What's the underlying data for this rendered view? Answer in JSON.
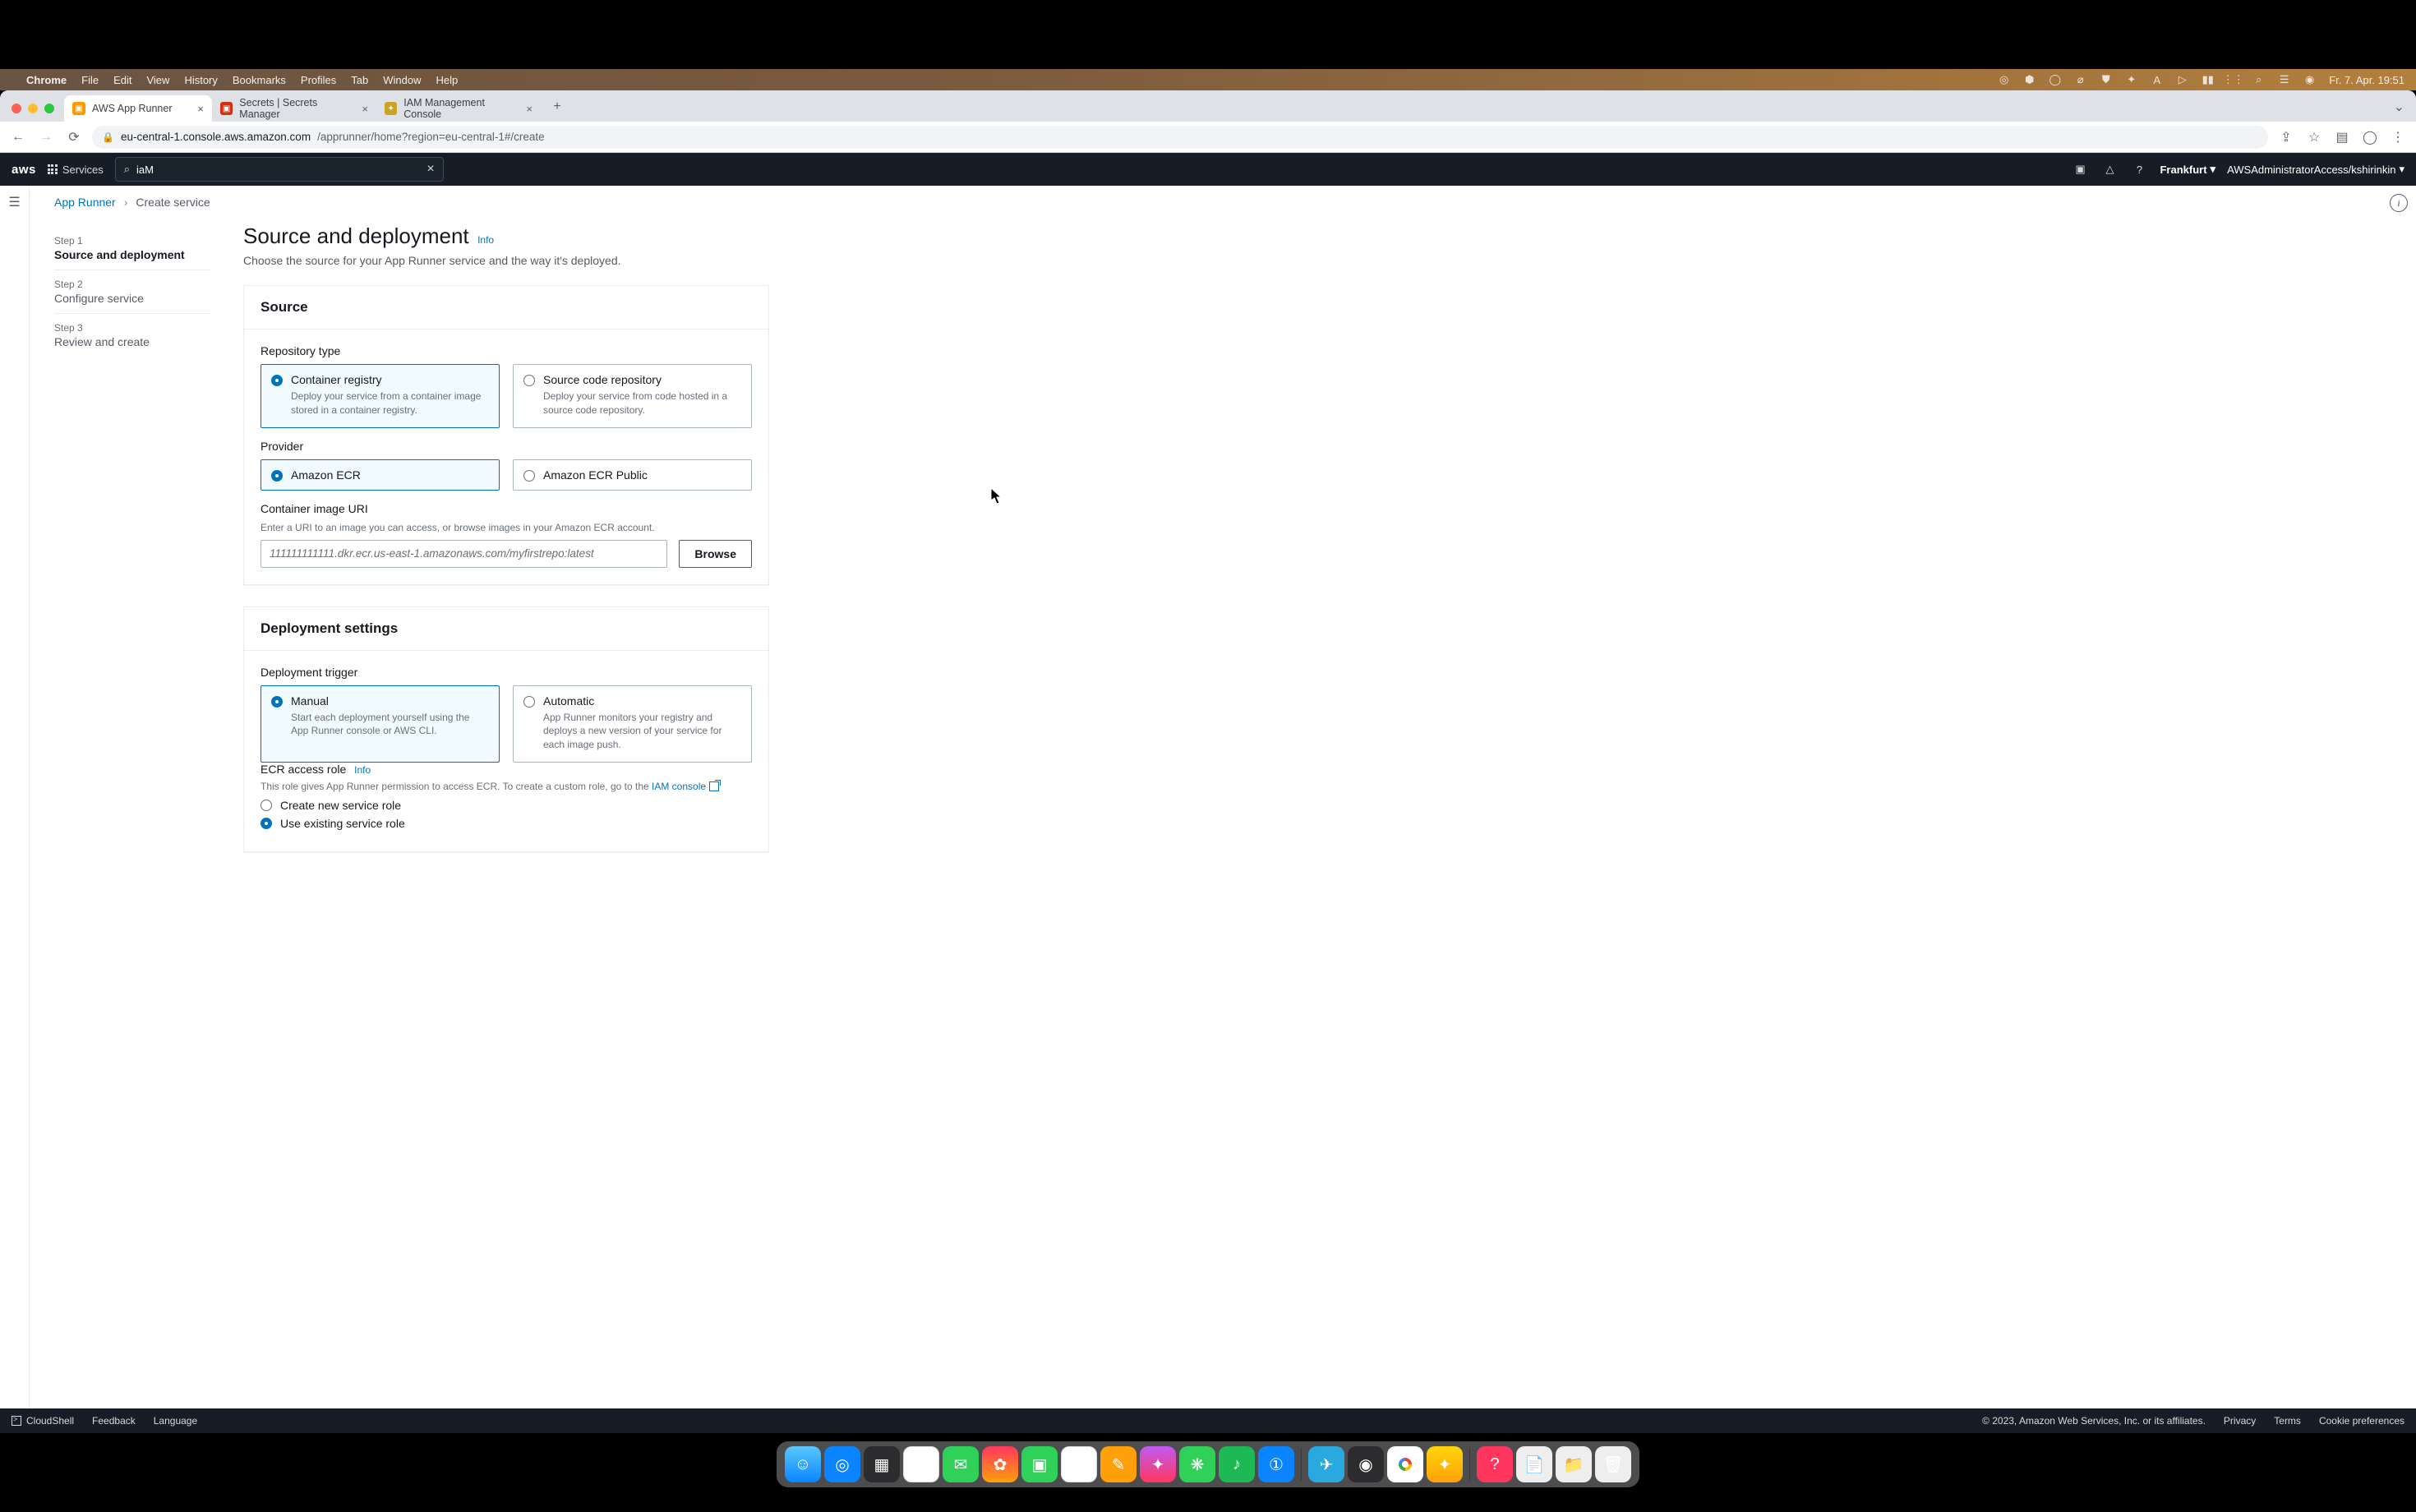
{
  "mac": {
    "app": "Chrome",
    "menus": [
      "File",
      "Edit",
      "View",
      "History",
      "Bookmarks",
      "Profiles",
      "Tab",
      "Window",
      "Help"
    ],
    "clock": "Fr. 7. Apr.  19:51"
  },
  "tabs": [
    {
      "title": "AWS App Runner",
      "active": true
    },
    {
      "title": "Secrets | Secrets Manager",
      "active": false
    },
    {
      "title": "IAM Management Console",
      "active": false
    }
  ],
  "url": {
    "host": "eu-central-1.console.aws.amazon.com",
    "path": "/apprunner/home?region=eu-central-1#/create"
  },
  "aws": {
    "services_label": "Services",
    "search_value": "iaM",
    "region": "Frankfurt",
    "account": "AWSAdministratorAccess/kshirinkin"
  },
  "breadcrumb": {
    "root": "App Runner",
    "current": "Create service"
  },
  "steps": [
    {
      "label": "Step 1",
      "title": "Source and deployment",
      "active": true
    },
    {
      "label": "Step 2",
      "title": "Configure service",
      "active": false
    },
    {
      "label": "Step 3",
      "title": "Review and create",
      "active": false
    }
  ],
  "page": {
    "title": "Source and deployment",
    "info": "Info",
    "subtitle": "Choose the source for your App Runner service and the way it's deployed."
  },
  "source": {
    "heading": "Source",
    "repo_type_label": "Repository type",
    "repo_options": [
      {
        "title": "Container registry",
        "desc": "Deploy your service from a container image stored in a container registry.",
        "selected": true
      },
      {
        "title": "Source code repository",
        "desc": "Deploy your service from code hosted in a source code repository.",
        "selected": false
      }
    ],
    "provider_label": "Provider",
    "provider_options": [
      {
        "title": "Amazon ECR",
        "selected": true
      },
      {
        "title": "Amazon ECR Public",
        "selected": false
      }
    ],
    "uri_label": "Container image URI",
    "uri_help": "Enter a URI to an image you can access, or browse images in your Amazon ECR account.",
    "uri_placeholder": "111111111111.dkr.ecr.us-east-1.amazonaws.com/myfirstrepo:latest",
    "browse": "Browse"
  },
  "deploy": {
    "heading": "Deployment settings",
    "trigger_label": "Deployment trigger",
    "trigger_options": [
      {
        "title": "Manual",
        "desc": "Start each deployment yourself using the App Runner console or AWS CLI.",
        "selected": true
      },
      {
        "title": "Automatic",
        "desc": "App Runner monitors your registry and deploys a new version of your service for each image push.",
        "selected": false
      }
    ],
    "ecr_role_label": "ECR access role",
    "ecr_role_info": "Info",
    "ecr_role_help_prefix": "This role gives App Runner permission to access ECR. To create a custom role, go to the ",
    "ecr_role_link": "IAM console",
    "ecr_role_options": [
      {
        "title": "Create new service role",
        "selected": false
      },
      {
        "title": "Use existing service role",
        "selected": true
      }
    ]
  },
  "footer": {
    "cloudshell": "CloudShell",
    "feedback": "Feedback",
    "language": "Language",
    "copyright": "© 2023, Amazon Web Services, Inc. or its affiliates.",
    "links": [
      "Privacy",
      "Terms",
      "Cookie preferences"
    ]
  }
}
